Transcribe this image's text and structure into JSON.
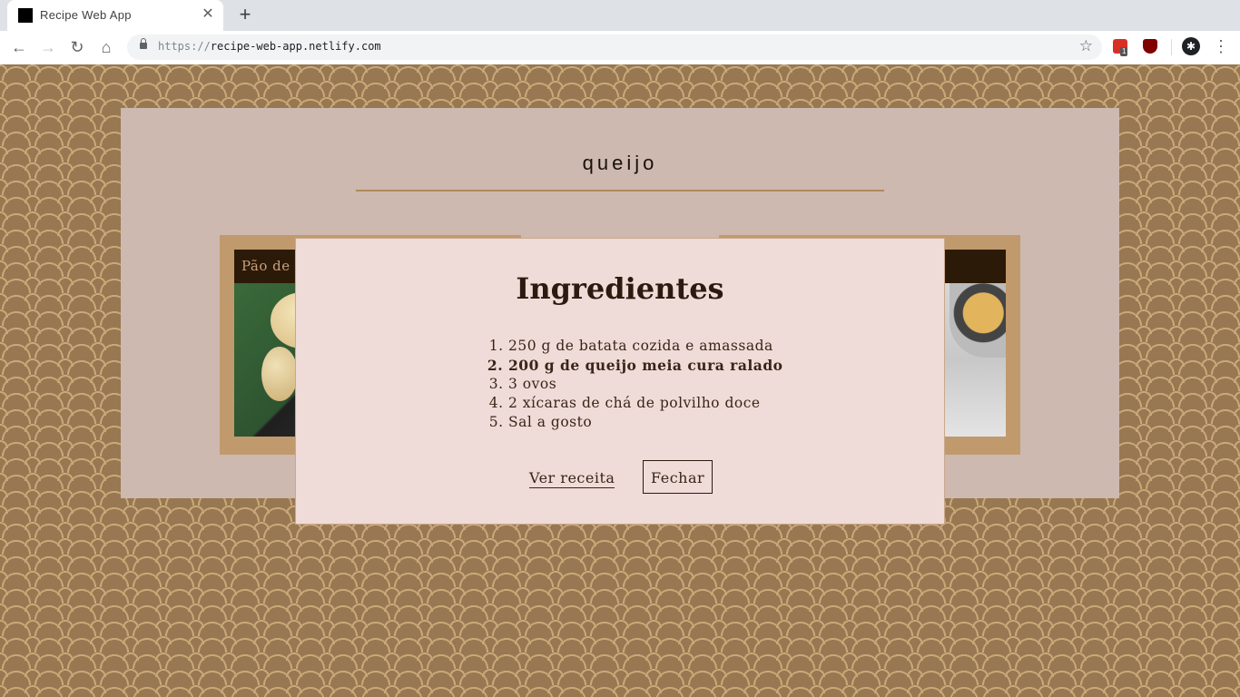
{
  "browser": {
    "tab_title": "Recipe Web App",
    "url_scheme": "https://",
    "url_host": "recipe-web-app.netlify.com",
    "extension_badge": "1"
  },
  "search": {
    "value": "queijo"
  },
  "cards": [
    {
      "title": "Pão de"
    },
    {
      "title": ""
    }
  ],
  "modal": {
    "title": "Ingredientes",
    "ingredients": [
      "250 g de batata cozida e amassada",
      "200 g de queijo meia cura ralado",
      "3 ovos",
      "2 xícaras de chá de polvilho doce",
      "Sal a gosto"
    ],
    "view_recipe_label": "Ver receita",
    "close_label": "Fechar"
  }
}
